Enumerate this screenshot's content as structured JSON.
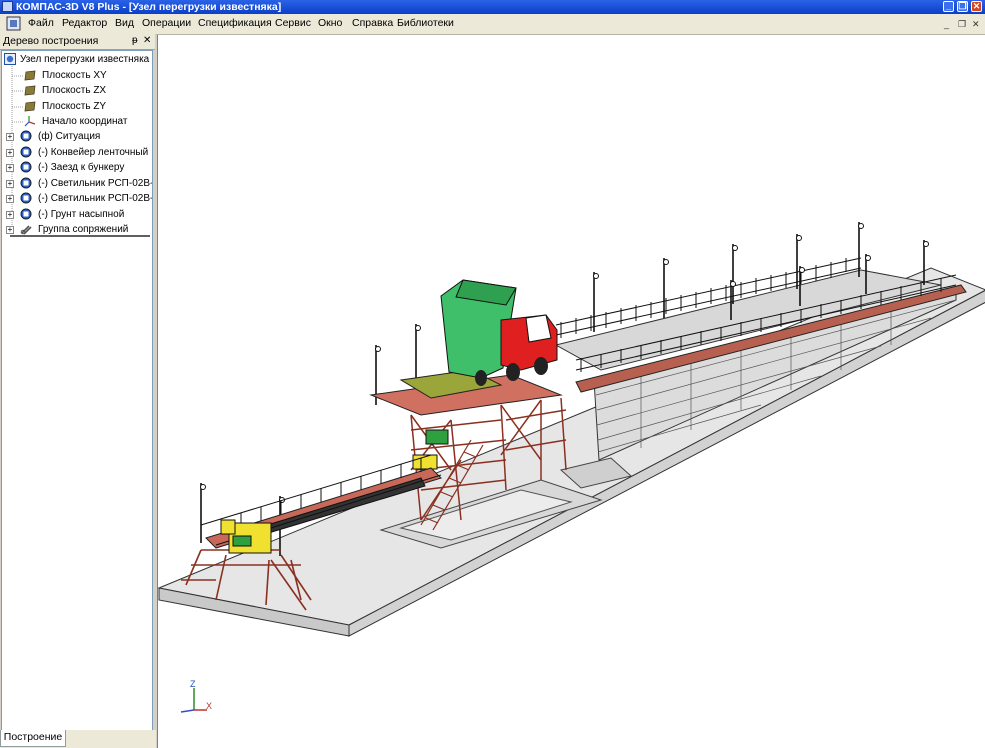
{
  "window": {
    "title": "КОМПАС-3D V8 Plus - [Узел перегрузки известняка]",
    "controls": [
      "minimize-icon",
      "restore-icon",
      "close-icon"
    ]
  },
  "menu": {
    "items": [
      "Файл",
      "Редактор",
      "Вид",
      "Операции",
      "Спецификация",
      "Сервис",
      "Окно",
      "Справка",
      "Библиотеки"
    ]
  },
  "tree_panel": {
    "title": "Дерево построения",
    "pin": "ᵽ",
    "close": "✕",
    "root": "Узел перегрузки известняка",
    "nodes": [
      {
        "label": "Плоскость XY",
        "icon": "plane-icon",
        "expandable": false
      },
      {
        "label": "Плоскость ZX",
        "icon": "plane-icon",
        "expandable": false
      },
      {
        "label": "Плоскость ZY",
        "icon": "plane-icon",
        "expandable": false
      },
      {
        "label": "Начало координат",
        "icon": "origin-icon",
        "expandable": false
      },
      {
        "label": "(ф) Ситуация",
        "icon": "component-icon",
        "expandable": true
      },
      {
        "label": "(-) Конвейер ленточный",
        "icon": "component-icon",
        "expandable": true
      },
      {
        "label": "(-) Заезд к бункеру",
        "icon": "component-icon",
        "expandable": true
      },
      {
        "label": "(-) Светильник РСП-02В-",
        "icon": "component-icon",
        "expandable": true
      },
      {
        "label": "(-) Светильник РСП-02В-",
        "icon": "component-icon",
        "expandable": true
      },
      {
        "label": "(-) Грунт насыпной",
        "icon": "component-icon",
        "expandable": true
      },
      {
        "label": "Группа сопряжений",
        "icon": "mates-icon",
        "expandable": true
      }
    ],
    "bottom_tab": "Построение"
  },
  "viewport": {
    "axes": {
      "z": "Z",
      "x": "X"
    }
  },
  "colors": {
    "title_bar": "#0a3fc8",
    "steel": "#e08070",
    "truck_cab": "#e02020",
    "truck_bed": "#3fbf6a",
    "hopper": "#9aa63a",
    "drive": "#f0e030",
    "ground": "#e6e6e6",
    "wall": "#dcdcdc"
  }
}
